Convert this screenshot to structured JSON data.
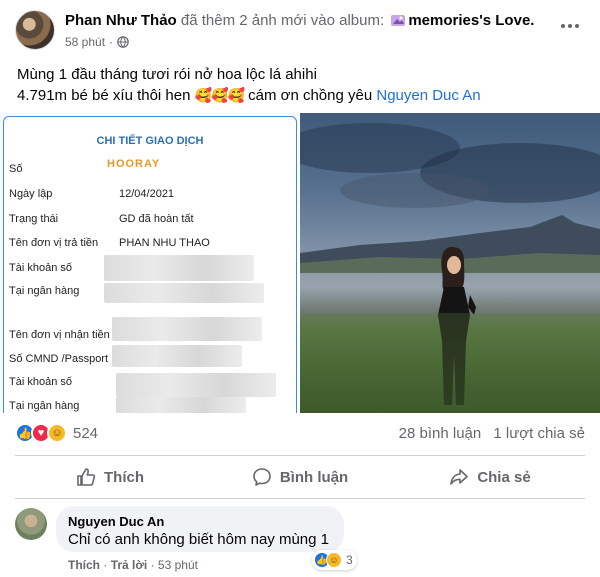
{
  "post": {
    "author": "Phan Như Thảo",
    "action_text": " đã thêm 2 ảnh mới vào album: ",
    "album_name": "memories's Love.",
    "time": "58 phút",
    "privacy_separator": "·",
    "caption_line1": "Mùng 1 đầu tháng tươi rói nở hoa lộc lá ahihi",
    "caption_line2_prefix": "4.791m bé bé xíu thôi hen ",
    "caption_emojis": "🥰🥰🥰",
    "caption_line2_suffix": " cám ơn chồng yêu ",
    "mention": "Nguyen Duc An"
  },
  "receipt": {
    "title": "CHI TIẾT GIAO DỊCH",
    "rows": [
      {
        "label": "Số",
        "value": ""
      },
      {
        "label": "Ngày lập",
        "value": "12/04/2021"
      },
      {
        "label": "Trạng thái",
        "value": "GD đã hoàn tất"
      },
      {
        "label": "Tên đơn vị trả tiền",
        "value": "PHAN NHU THAO"
      },
      {
        "label": "Tài khoản số",
        "value": ""
      },
      {
        "label": "Tại ngân hàng",
        "value": ""
      },
      {
        "label": "Tên đơn vị nhận tiền",
        "value": ""
      },
      {
        "label": "Số CMND /Passport",
        "value": ""
      },
      {
        "label": "Tài khoản số",
        "value": ""
      },
      {
        "label": "Tại ngân hàng",
        "value": ""
      }
    ],
    "stamp_text": "HOORAY"
  },
  "stats": {
    "reaction_count": "524",
    "comments": "28 bình luận",
    "shares": "1 lượt chia sẻ"
  },
  "actions": {
    "like": "Thích",
    "comment": "Bình luận",
    "share": "Chia sẻ"
  },
  "comment": {
    "name": "Nguyen Duc An",
    "text": "Chỉ có anh không biết hôm nay mùng 1",
    "reaction_count": "3",
    "like": "Thích",
    "reply": "Trả lời",
    "time": "53 phút",
    "separator": "·"
  },
  "colors": {
    "link": "#216fdb",
    "like_blue": "#1b74e4",
    "love_red": "#f0284a",
    "secondary_text": "#65676b"
  }
}
